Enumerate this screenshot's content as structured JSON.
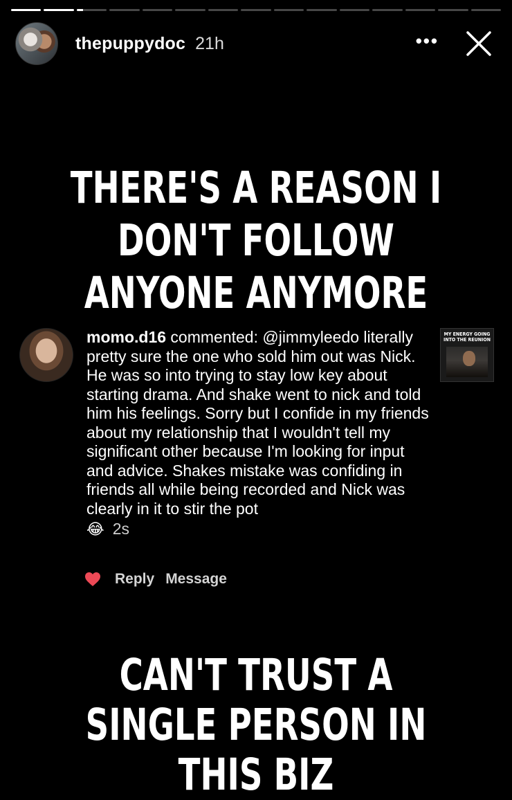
{
  "progress": {
    "segments": 15,
    "completed": 2,
    "current_fill": 0.2
  },
  "header": {
    "username": "thepuppydoc",
    "time": "21h",
    "more": "•••",
    "icons": {
      "more": "more-options-icon",
      "close": "close-icon"
    }
  },
  "headline_top": "THERE'S A REASON I DON'T FOLLOW ANYONE ANYMORE",
  "comment": {
    "user": "momo.d16",
    "text": " commented: @jimmyleedo literally pretty sure the one who sold him out was Nick. He was so into trying to stay low key about starting drama. And shake went to nick and told him his feelings. Sorry but I confide in my friends about my relationship that I wouldn't tell my significant other because I'm looking for input and advice. Shakes mistake was confiding in friends all while being recorded and Nick was clearly in it to stir the pot",
    "emoji": "😂",
    "time": "2s",
    "thumbnail_text": "MY ENERGY GOING INTO THE REUNION"
  },
  "actions": {
    "reply": "Reply",
    "message": "Message",
    "like_color": "#ed4956"
  },
  "headline_bottom": "CAN'T TRUST A SINGLE PERSON IN THIS BIZ"
}
